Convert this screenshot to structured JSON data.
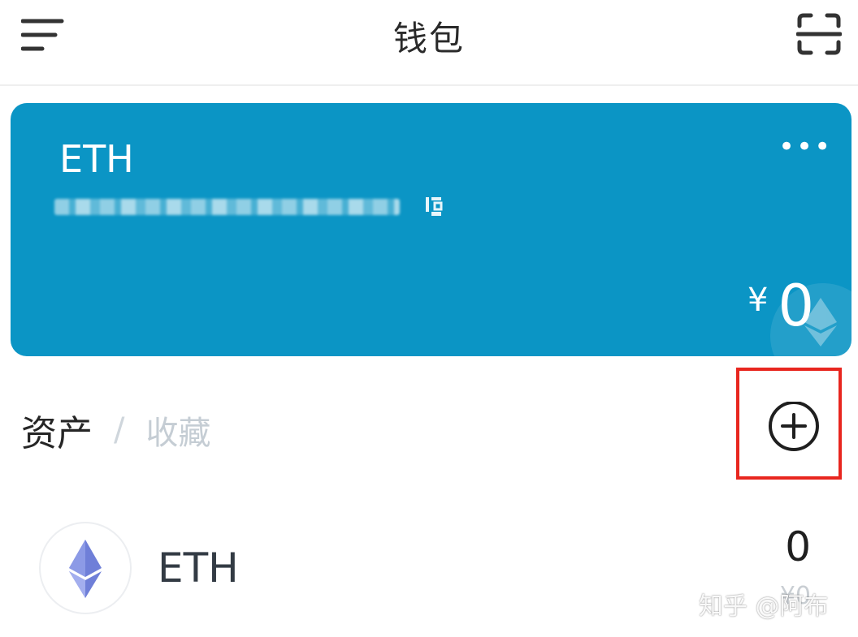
{
  "header": {
    "title": "钱包",
    "menu_icon": "menu-icon",
    "scan_icon": "scan-icon"
  },
  "wallet_card": {
    "name": "ETH",
    "more_label": "•••",
    "address_blurred": true,
    "currency_symbol": "¥",
    "balance": "0",
    "background_color": "#0b95c5"
  },
  "tabs": {
    "assets_label": "资产",
    "separator": "/",
    "favorites_label": "收藏"
  },
  "add_button": {
    "icon": "plus-circle-icon",
    "highlight_color": "#e8261f"
  },
  "assets": [
    {
      "name": "ETH",
      "balance": "0",
      "sub_value": "¥0",
      "icon": "ethereum-icon"
    }
  ],
  "watermark": "知乎 @阿布"
}
